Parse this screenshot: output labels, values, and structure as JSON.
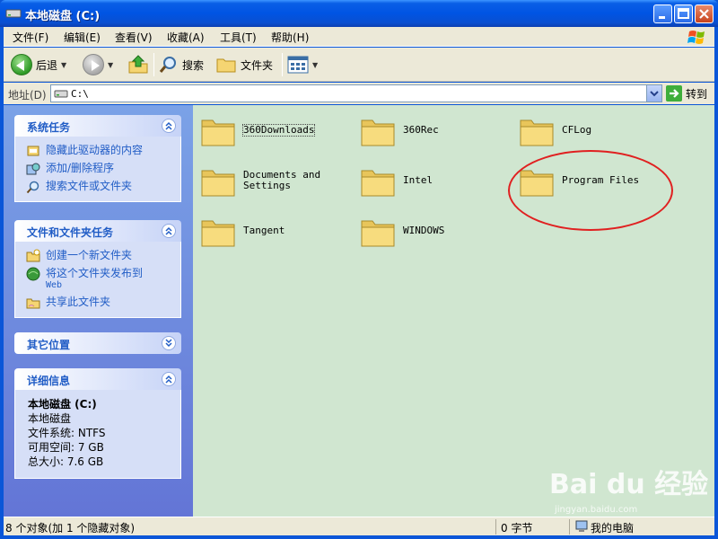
{
  "window": {
    "title": "本地磁盘 (C:)"
  },
  "menu": [
    "文件(F)",
    "编辑(E)",
    "查看(V)",
    "收藏(A)",
    "工具(T)",
    "帮助(H)"
  ],
  "toolbar": {
    "back": "后退",
    "search": "搜索",
    "folders": "文件夹"
  },
  "address": {
    "label": "地址(D)",
    "value": "C:\\",
    "go": "转到"
  },
  "panels": {
    "system_tasks": {
      "title": "系统任务",
      "items": [
        "隐藏此驱动器的内容",
        "添加/删除程序",
        "搜索文件或文件夹"
      ]
    },
    "file_tasks": {
      "title": "文件和文件夹任务",
      "items": [
        "创建一个新文件夹",
        "将这个文件夹发布到",
        "Web",
        "共享此文件夹"
      ]
    },
    "other_places": {
      "title": "其它位置"
    },
    "details": {
      "title": "详细信息",
      "name": "本地磁盘 (C:)",
      "type": "本地磁盘",
      "fs": "文件系统: NTFS",
      "free": "可用空间: 7 GB",
      "total": "总大小: 7.6 GB"
    }
  },
  "files": [
    {
      "name": "360Downloads"
    },
    {
      "name": "360Rec"
    },
    {
      "name": "CFLog"
    },
    {
      "name": "Documents and\nSettings"
    },
    {
      "name": "Intel"
    },
    {
      "name": "Program Files"
    },
    {
      "name": "Tangent"
    },
    {
      "name": "WINDOWS"
    }
  ],
  "status": {
    "objects": "8 个对象(加 1 个隐藏对象)",
    "size": "0 字节",
    "location": "我的电脑"
  },
  "watermark": {
    "brand": "Bai du 经验",
    "url": "jingyan.baidu.com"
  }
}
